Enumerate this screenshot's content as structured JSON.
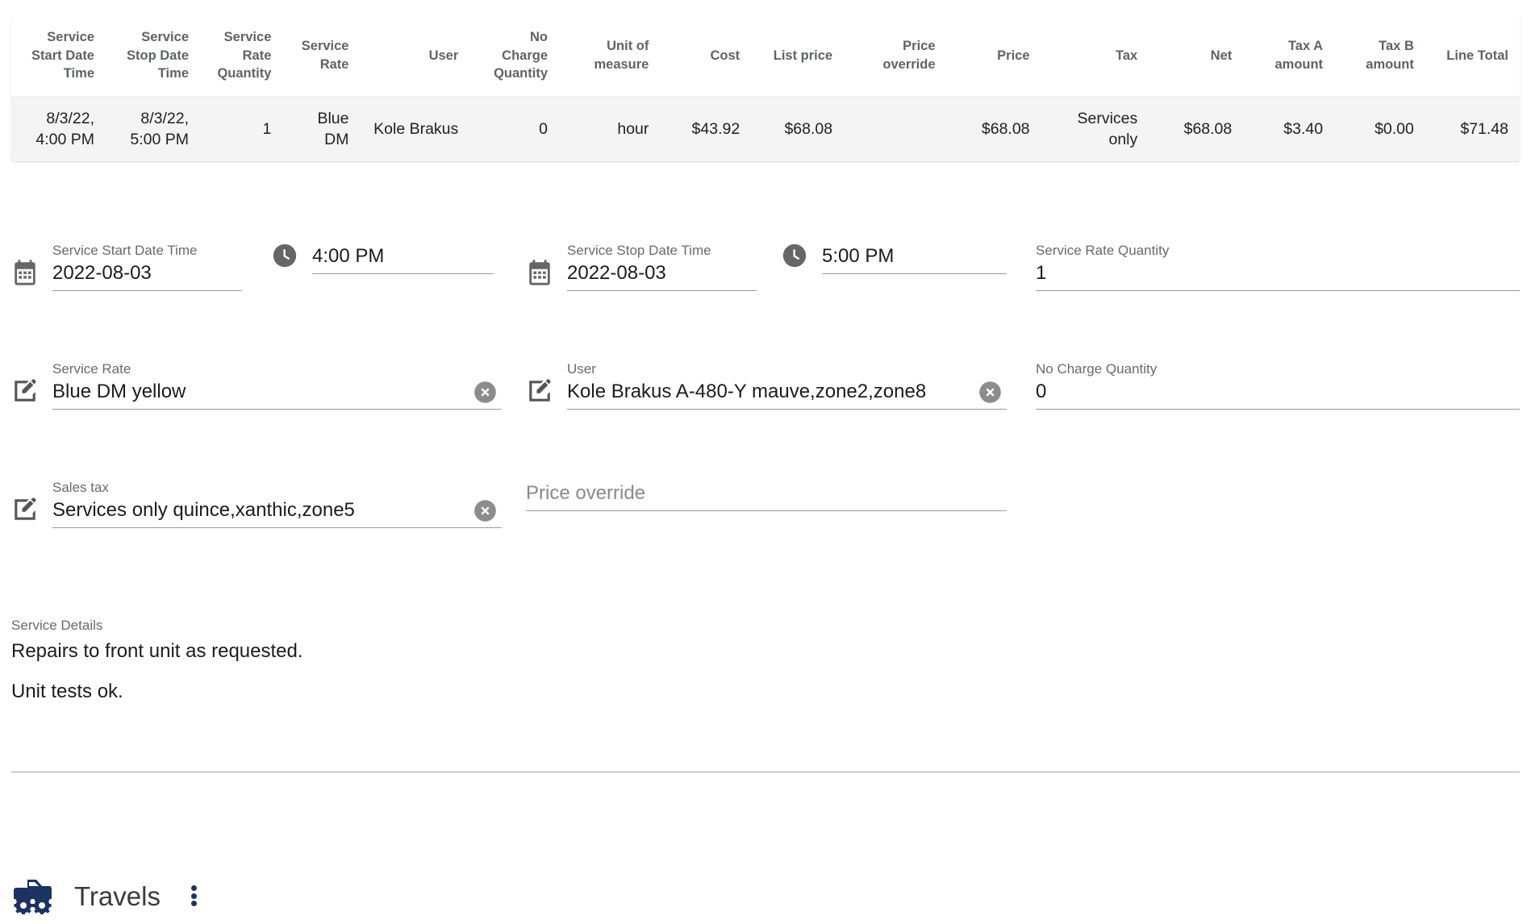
{
  "table": {
    "columns": [
      "Service Start Date Time",
      "Service Stop Date Time",
      "Service Rate Quantity",
      "Service Rate",
      "User",
      "No Charge Quantity",
      "Unit of measure",
      "Cost",
      "List price",
      "Price override",
      "Price",
      "Tax",
      "Net",
      "Tax A amount",
      "Tax B amount",
      "Line Total"
    ],
    "rows": [
      {
        "service_start_date_time": "8/3/22, 4:00 PM",
        "service_stop_date_time": "8/3/22, 5:00 PM",
        "service_rate_quantity": "1",
        "service_rate": "Blue DM",
        "user": "Kole Brakus",
        "no_charge_quantity": "0",
        "unit_of_measure": "hour",
        "cost": "$43.92",
        "list_price": "$68.08",
        "price_override": "",
        "price": "$68.08",
        "tax": "Services only",
        "net": "$68.08",
        "tax_a_amount": "$3.40",
        "tax_b_amount": "$0.00",
        "line_total": "$71.48"
      }
    ]
  },
  "form": {
    "service_start_date": {
      "label": "Service Start Date Time",
      "value": "2022-08-03",
      "icon": "calendar-icon"
    },
    "service_start_time": {
      "label": "",
      "value": "4:00 PM",
      "icon": "clock-icon"
    },
    "service_stop_date": {
      "label": "Service Stop Date Time",
      "value": "2022-08-03",
      "icon": "calendar-icon"
    },
    "service_stop_time": {
      "label": "",
      "value": "5:00 PM",
      "icon": "clock-icon"
    },
    "service_rate_quantity": {
      "label": "Service Rate Quantity",
      "value": "1"
    },
    "service_rate": {
      "label": "Service Rate",
      "value": "Blue DM yellow",
      "icon": "edit-icon",
      "clear": "clear-icon"
    },
    "user": {
      "label": "User",
      "value": "Kole Brakus A-480-Y mauve,zone2,zone8",
      "icon": "edit-icon",
      "clear": "clear-icon"
    },
    "no_charge_quantity": {
      "label": "No Charge Quantity",
      "value": "0"
    },
    "sales_tax": {
      "label": "Sales tax",
      "value": "Services only quince,xanthic,zone5",
      "icon": "edit-icon",
      "clear": "clear-icon"
    },
    "price_override": {
      "label": "",
      "value": "",
      "placeholder": "Price override"
    }
  },
  "service_details": {
    "label": "Service Details",
    "paragraphs": [
      "Repairs to front unit as requested.",
      "Unit tests ok."
    ]
  },
  "travels": {
    "title": "Travels",
    "icon": "monster-truck-icon",
    "menu_icon": "more-vert-icon",
    "accent_color": "#1c3262"
  }
}
